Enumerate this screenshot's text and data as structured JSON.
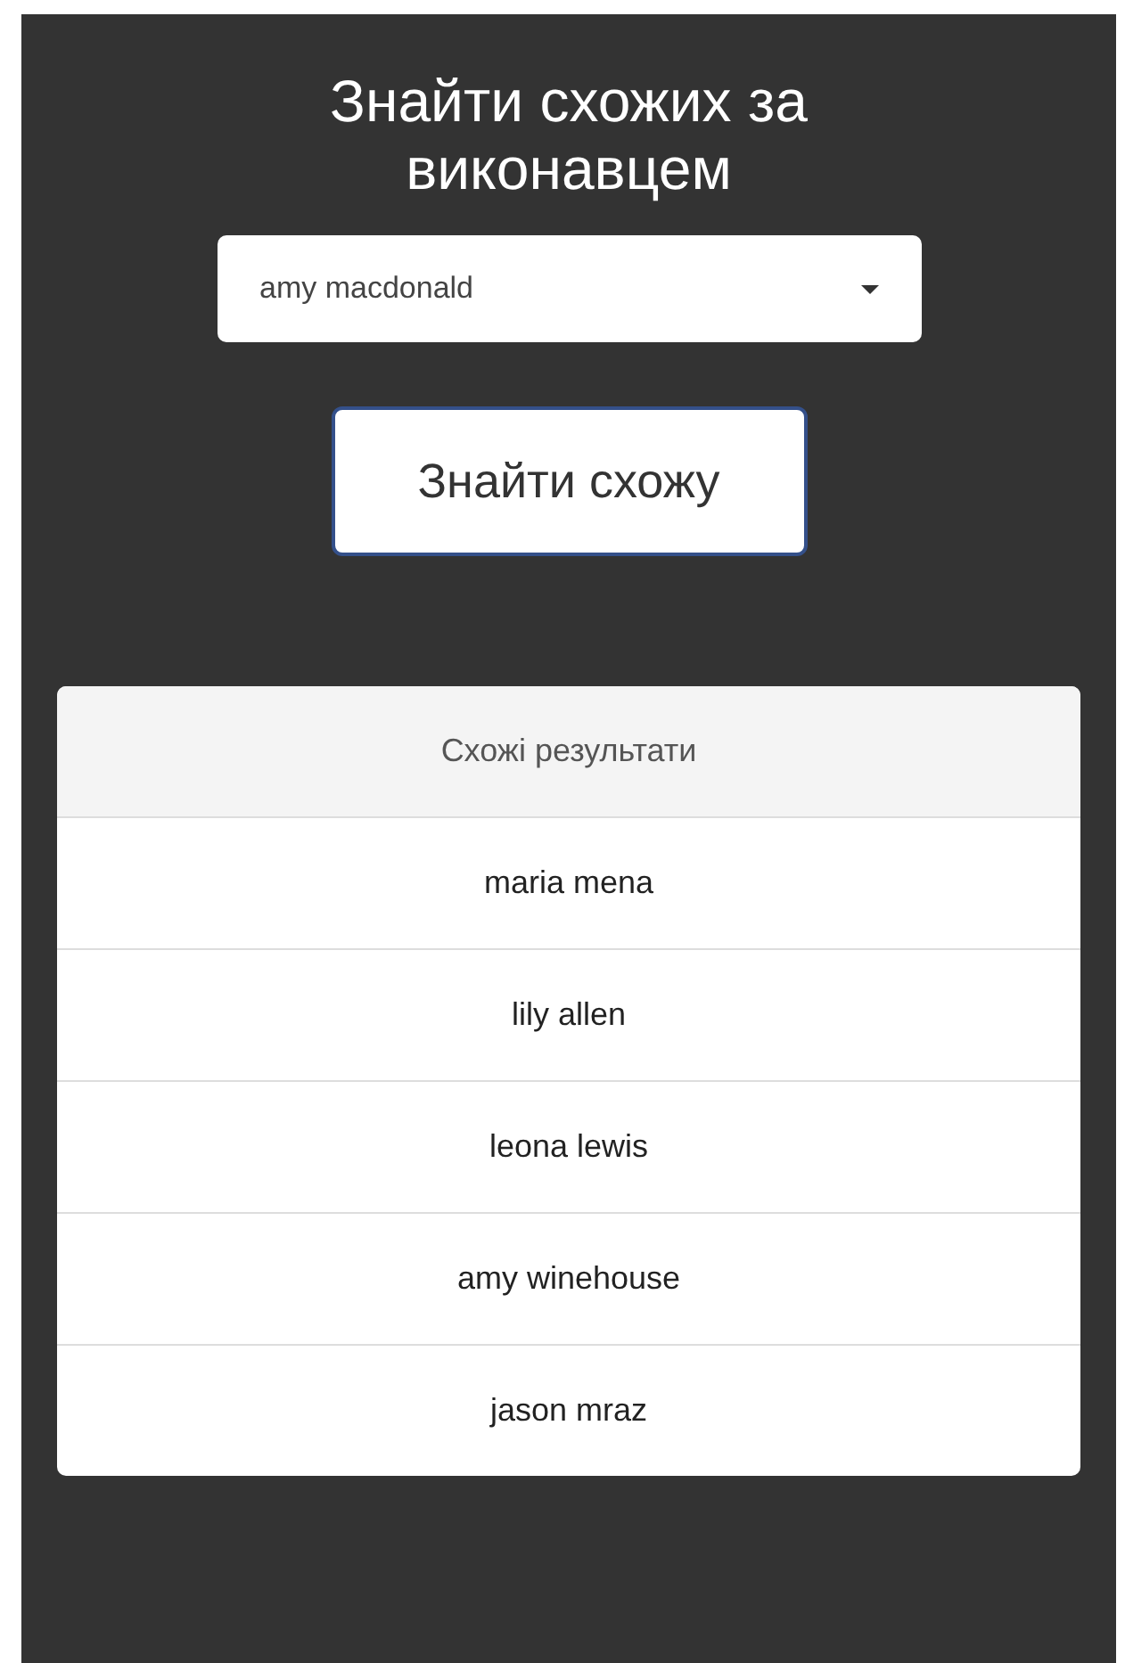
{
  "title": "Знайти схожих за виконавцем",
  "artist_select": {
    "value": "amy macdonald"
  },
  "search_button": {
    "label": "Знайти схожу"
  },
  "results": {
    "header": "Схожі результати",
    "items": [
      "maria mena",
      "lily allen",
      "leona lewis",
      "amy winehouse",
      "jason mraz"
    ]
  }
}
